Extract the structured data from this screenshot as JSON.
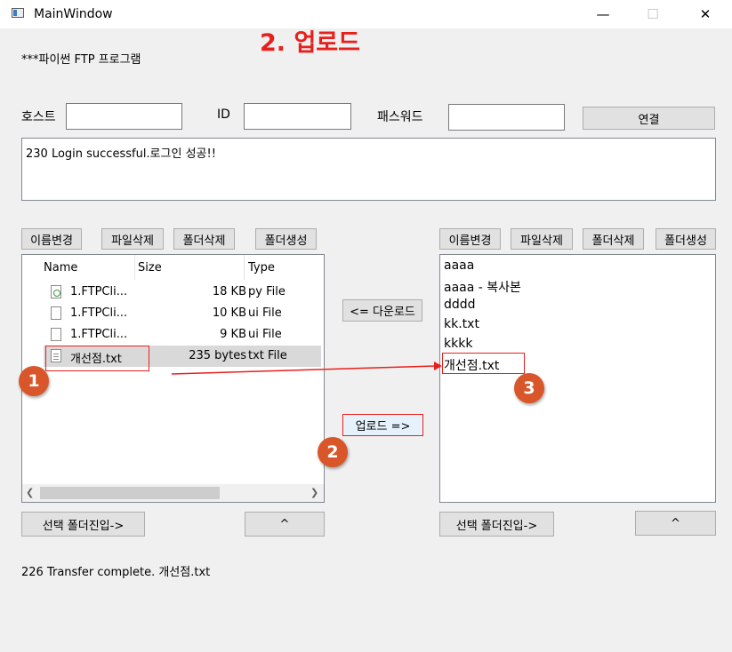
{
  "window": {
    "title": "MainWindow",
    "minimize": "—",
    "maximize": "☐",
    "close": "✕"
  },
  "annotation": {
    "title": "2. 업로드",
    "callout1": "1",
    "callout2": "2",
    "callout3": "3"
  },
  "app": {
    "heading": "***파이썬 FTP 프로그램"
  },
  "login": {
    "host_label": "호스트",
    "host_value": "",
    "id_label": "ID",
    "id_value": "",
    "password_label": "패스워드",
    "password_value": "",
    "connect_label": "연결"
  },
  "log": {
    "text": "230 Login successful.로그인 성공!!"
  },
  "local": {
    "buttons": {
      "rename": "이름변경",
      "delete_file": "파일삭제",
      "delete_folder": "폴더삭제",
      "create_folder": "폴더생성"
    },
    "columns": {
      "name": "Name",
      "size": "Size",
      "type": "Type"
    },
    "files": [
      {
        "name": "1.FTPCli...",
        "size": "18 KB",
        "type": "py File",
        "icon": "python-file-icon"
      },
      {
        "name": "1.FTPCli...",
        "size": "10 KB",
        "type": "ui File",
        "icon": "document-file-icon"
      },
      {
        "name": "1.FTPCli...",
        "size": "9 KB",
        "type": "ui File",
        "icon": "document-file-icon"
      },
      {
        "name": "개선점.txt",
        "size": "235 bytes",
        "type": "txt File",
        "icon": "text-file-icon"
      }
    ],
    "enter_folder": "선택 폴더진입->",
    "up": "^"
  },
  "transfer": {
    "download": "<= 다운로드",
    "upload": "업로드 =>"
  },
  "remote": {
    "buttons": {
      "rename": "이름변경",
      "delete_file": "파일삭제",
      "delete_folder": "폴더삭제",
      "create_folder": "폴더생성"
    },
    "files": [
      "aaaa",
      "aaaa - 복사본",
      "dddd",
      "kk.txt",
      "kkkk",
      "개선점.txt"
    ],
    "enter_folder": "선택 폴더진입->",
    "up": "^"
  },
  "status": {
    "text": "226 Transfer complete. 개선점.txt"
  },
  "colors": {
    "annotation_red": "#e8201c",
    "callout_orange": "#d9562a",
    "selection": "#d9d9d9"
  }
}
